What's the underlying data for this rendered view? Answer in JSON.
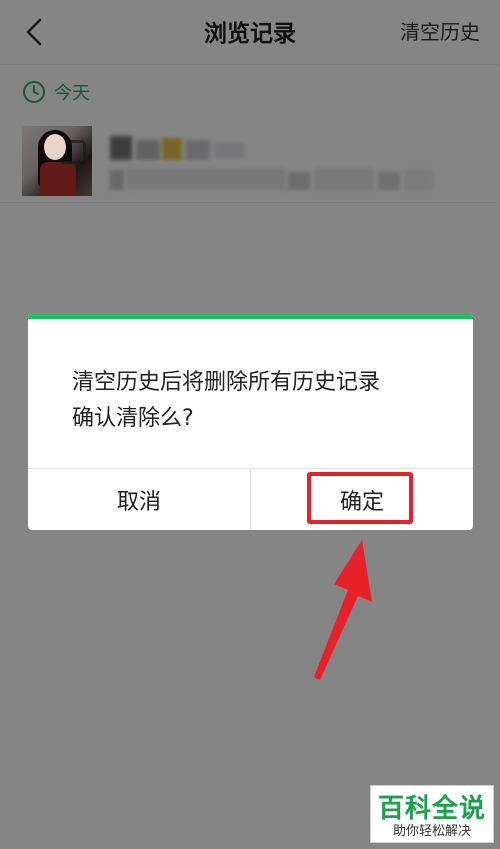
{
  "navbar": {
    "back_icon": "chevron-left-icon",
    "title": "浏览记录",
    "clear_label": "清空历史"
  },
  "section": {
    "icon": "clock-icon",
    "label": "今天",
    "accent_color": "#2ea86a"
  },
  "dialog": {
    "accent_color": "#1fbf5b",
    "message_line1": "清空历史后将删除所有历史记录",
    "message_line2": "确认清除么?",
    "cancel_label": "取消",
    "confirm_label": "确定",
    "highlight_color": "#e8202a"
  },
  "watermark": {
    "title": "百科全说",
    "subtitle": "助你轻松解决"
  }
}
